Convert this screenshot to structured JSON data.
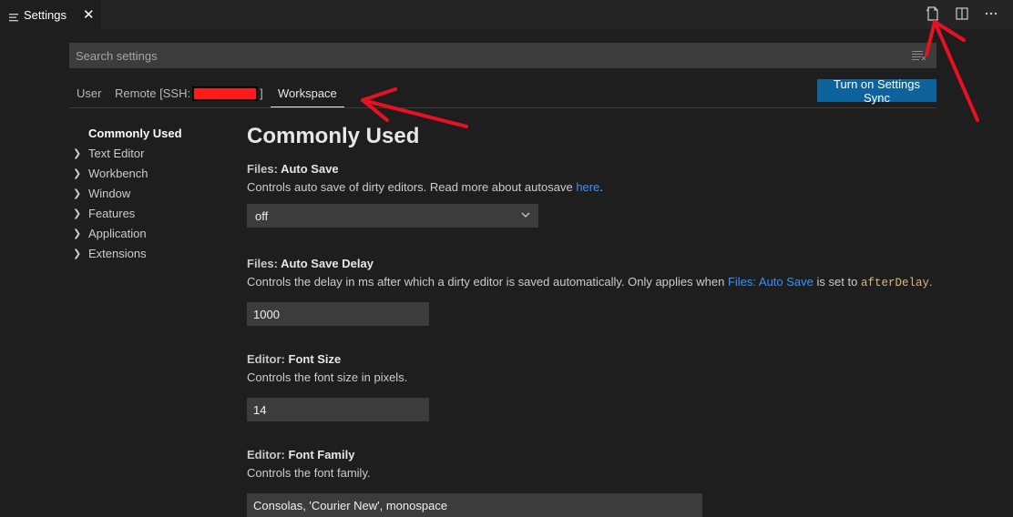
{
  "tab": {
    "label": "Settings",
    "close": "✕"
  },
  "search": {
    "placeholder": "Search settings"
  },
  "scope_tabs": {
    "user": "User",
    "remote_prefix": "Remote [SSH:",
    "remote_suffix": "]",
    "workspace": "Workspace"
  },
  "sync_button": "Turn on Settings Sync",
  "toc": {
    "items": [
      {
        "label": "Commonly Used",
        "selected": true
      },
      {
        "label": "Text Editor"
      },
      {
        "label": "Workbench"
      },
      {
        "label": "Window"
      },
      {
        "label": "Features"
      },
      {
        "label": "Application"
      },
      {
        "label": "Extensions"
      }
    ]
  },
  "section_title": "Commonly Used",
  "settings": {
    "auto_save": {
      "category": "Files: ",
      "name": "Auto Save",
      "desc_before": "Controls auto save of dirty editors. Read more about autosave ",
      "desc_link": "here",
      "desc_after": ".",
      "value": "off"
    },
    "auto_save_delay": {
      "category": "Files: ",
      "name": "Auto Save Delay",
      "desc_before": "Controls the delay in ms after which a dirty editor is saved automatically. Only applies when ",
      "desc_link": "Files: Auto Save",
      "desc_middle": " is set to ",
      "desc_code": "afterDelay",
      "desc_after": ".",
      "value": "1000"
    },
    "font_size": {
      "category": "Editor: ",
      "name": "Font Size",
      "desc": "Controls the font size in pixels.",
      "value": "14"
    },
    "font_family": {
      "category": "Editor: ",
      "name": "Font Family",
      "desc": "Controls the font family.",
      "value": "Consolas, 'Courier New', monospace"
    }
  },
  "colors": {
    "accent": "#0e639c",
    "link": "#3794ff",
    "annotation": "#e81123"
  }
}
